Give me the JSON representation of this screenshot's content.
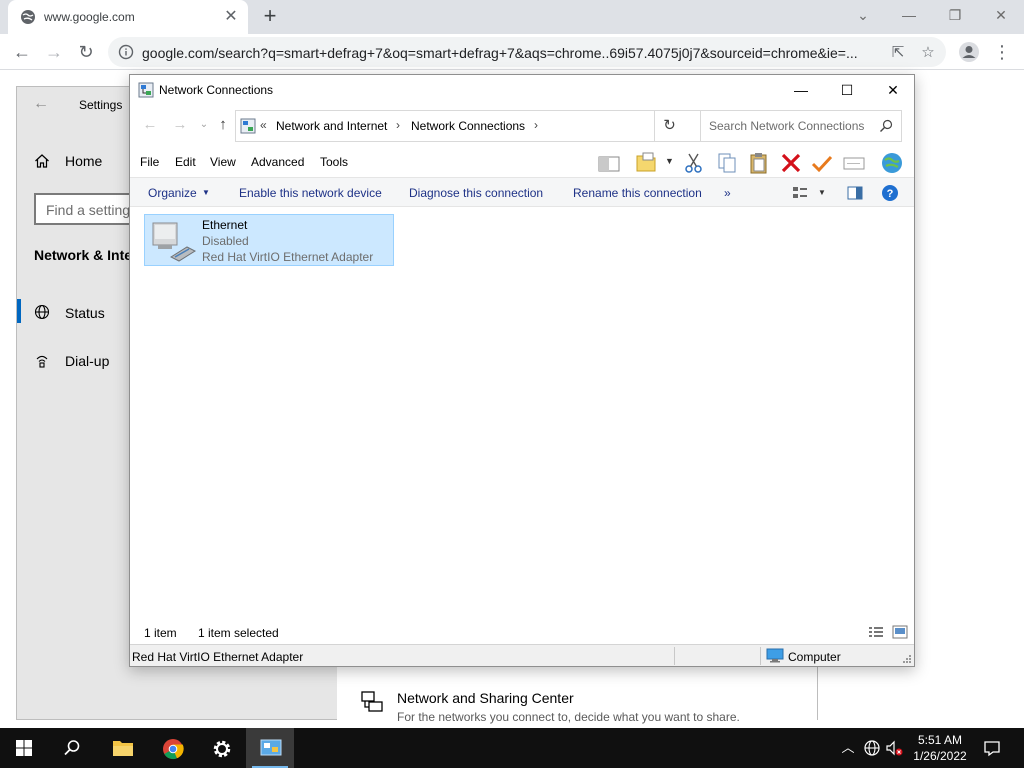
{
  "browser": {
    "tab_title": "www.google.com",
    "tab_close": "✕",
    "new_tab": "+",
    "url": "google.com/search?q=smart+defrag+7&oq=smart+defrag+7&aqs=chrome..69i57.4075j0j7&sourceid=chrome&ie=...",
    "controls": {
      "dropdown": "⌄",
      "minimize": "—",
      "restore": "❐",
      "close": "✕"
    }
  },
  "settings": {
    "title": "Settings",
    "home": "Home",
    "find_placeholder": "Find a setting",
    "section": "Network & Internet",
    "nav": [
      {
        "label": "Status",
        "icon": "globe-icon"
      },
      {
        "label": "Dial-up",
        "icon": "dialup-icon"
      }
    ],
    "card": {
      "title": "Network and Sharing Center",
      "desc": "For the networks you connect to, decide what you want to share."
    }
  },
  "explorer": {
    "title": "Network Connections",
    "breadcrumb": {
      "overflow": "«",
      "items": [
        "Network and Internet",
        "Network Connections"
      ]
    },
    "search_placeholder": "Search Network Connections",
    "menu": [
      "File",
      "Edit",
      "View",
      "Advanced",
      "Tools"
    ],
    "commands": {
      "organize": "Organize",
      "enable": "Enable this network device",
      "diagnose": "Diagnose this connection",
      "rename": "Rename this connection",
      "more": "»"
    },
    "items": [
      {
        "name": "Ethernet",
        "status": "Disabled",
        "device": "Red Hat VirtIO Ethernet Adapter"
      }
    ],
    "status": {
      "count": "1 item",
      "selected": "1 item selected"
    },
    "details": {
      "left": "Red Hat VirtIO Ethernet Adapter",
      "right": "Computer"
    }
  },
  "taskbar": {
    "time": "5:51 AM",
    "date": "1/26/2022",
    "accent": "#76b9ed"
  }
}
